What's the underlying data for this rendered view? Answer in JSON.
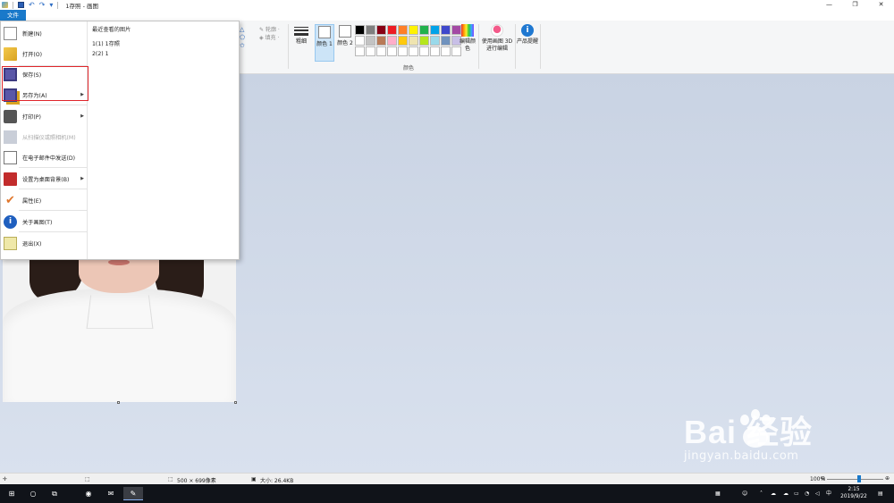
{
  "window": {
    "title": "1存照 - 画图",
    "minimize_glyph": "—",
    "restore_glyph": "❐",
    "close_glyph": "✕"
  },
  "ribbon": {
    "file_tab": "文件",
    "outline_label": "轮廓 ·",
    "fill_label": "填充 ·",
    "size_label": "粗细",
    "color1_label": "颜色 1",
    "color2_label": "颜色 2",
    "colors_group_label": "颜色",
    "edit_colors_label": "编辑颜色",
    "paint3d_label": "使用画图 3D 进行编辑",
    "product_alert_label": "产品提醒",
    "palette": [
      "#000000",
      "#7f7f7f",
      "#880015",
      "#ed1c24",
      "#ff7f27",
      "#fff200",
      "#22b14c",
      "#00a2e8",
      "#3f48cc",
      "#a349a4",
      "#ffffff",
      "#c3c3c3",
      "#b97a57",
      "#ffaec9",
      "#ffc90e",
      "#efe4b0",
      "#b5e61d",
      "#99d9ea",
      "#7092be",
      "#c8bfe7",
      "#ffffff",
      "#ffffff",
      "#ffffff",
      "#ffffff",
      "#ffffff",
      "#ffffff",
      "#ffffff",
      "#ffffff",
      "#ffffff",
      "#ffffff"
    ]
  },
  "file_menu": {
    "items": [
      {
        "label": "新建(N)",
        "icon": "new-file-icon"
      },
      {
        "label": "打开(O)",
        "icon": "open-folder-icon"
      },
      {
        "label": "保存(S)",
        "icon": "save-icon"
      },
      {
        "label": "另存为(A)",
        "icon": "save-as-icon"
      },
      {
        "label": "打印(P)",
        "icon": "printer-icon"
      },
      {
        "label": "从扫描仪或照相机(M)",
        "icon": "scanner-icon"
      },
      {
        "label": "在电子邮件中发送(D)",
        "icon": "email-icon"
      },
      {
        "label": "设置为桌面背景(B)",
        "icon": "desktop-background-icon"
      },
      {
        "label": "属性(E)",
        "icon": "properties-check-icon"
      },
      {
        "label": "关于画图(T)",
        "icon": "info-icon"
      },
      {
        "label": "退出(X)",
        "icon": "exit-icon"
      }
    ],
    "submenu_arrow": "▶",
    "recent_title": "最近查看的图片",
    "recent": [
      "1(1)  1存照",
      "2(2)  1"
    ]
  },
  "statusbar": {
    "dimensions": "500 × 699像素",
    "file_size": "大小: 26.4KB",
    "zoom": "100%",
    "zoom_out": "⊖",
    "zoom_in": "⊕"
  },
  "taskbar": {
    "ime": "中",
    "time": "2:15",
    "date": "2019/9/22"
  },
  "watermark": {
    "brand": "Bai   经验",
    "url": "jingyan.baidu.com"
  }
}
